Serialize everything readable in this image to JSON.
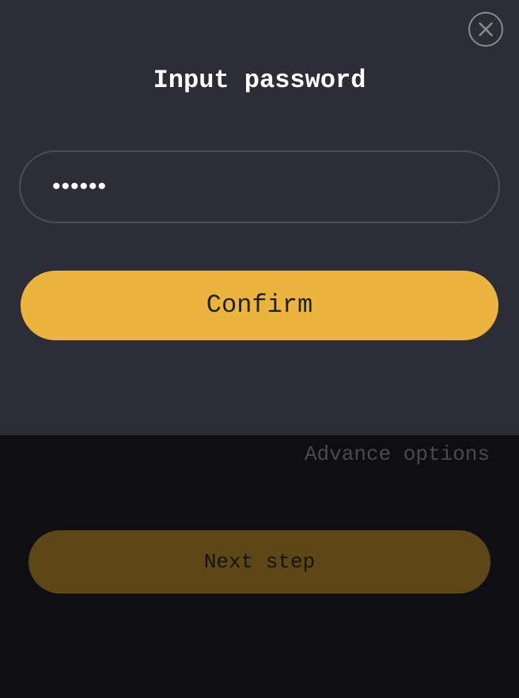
{
  "background_page": {
    "advance_options_label": "Advance options",
    "next_step_label": "Next step"
  },
  "password_dialog": {
    "title": "Input password",
    "password_value": "123456",
    "close_icon": "close-circle-icon",
    "confirm_label": "Confirm"
  },
  "colors": {
    "accent": "#eab43e",
    "modal_background": "#2d2d37",
    "overlay_background": "#0e0e13",
    "dimmed_accent": "#5d4718"
  }
}
